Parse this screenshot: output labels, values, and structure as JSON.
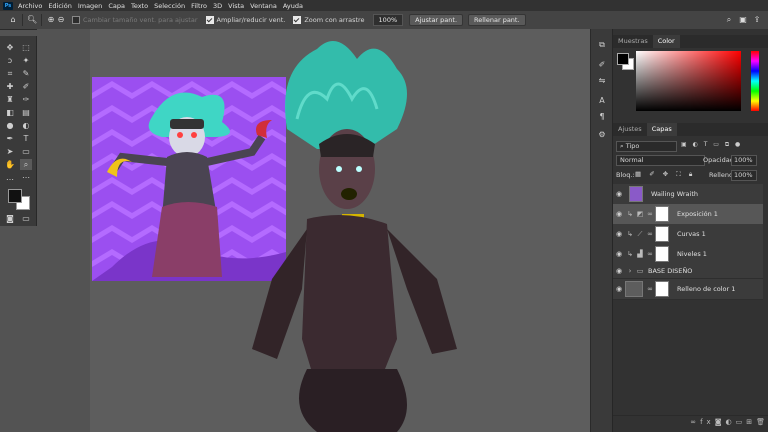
{
  "menu": {
    "items": [
      "Archivo",
      "Edición",
      "Imagen",
      "Capa",
      "Texto",
      "Selección",
      "Filtro",
      "3D",
      "Vista",
      "Ventana",
      "Ayuda"
    ]
  },
  "options": {
    "resize_windows_label": "Cambiar tamaño vent. para ajustar",
    "enlarge_label": "Ampliar/reducir vent.",
    "scrubby_label": "Zoom con arrastre",
    "zoom_value": "100%",
    "fit_screen": "Ajustar pant.",
    "fill_screen": "Rellenar pant."
  },
  "panels": {
    "top_tabs": [
      "Muestras",
      "Color"
    ],
    "adj_tabs": [
      "Ajustes",
      "Capas"
    ],
    "filter_kind": "Tipo",
    "blend_mode": "Normal",
    "opacity_label": "Opacidad:",
    "opacity_value": "100%",
    "lock_label": "Bloq.:",
    "fill_label": "Relleno:",
    "fill_value": "100%"
  },
  "layers": [
    {
      "name": "Wailing Wraith",
      "kind": "image"
    },
    {
      "name": "Exposición 1",
      "kind": "adjustment",
      "selected": true
    },
    {
      "name": "Curvas 1",
      "kind": "adjustment"
    },
    {
      "name": "Niveles 1",
      "kind": "adjustment"
    },
    {
      "name": "BASE DISEÑO",
      "kind": "group"
    },
    {
      "name": "Relleno de color 1",
      "kind": "fill"
    }
  ],
  "colors": {
    "ps_blue": "#31a8ff",
    "purple_bg": "#9a4df0",
    "hair": "#3fd6c5"
  }
}
